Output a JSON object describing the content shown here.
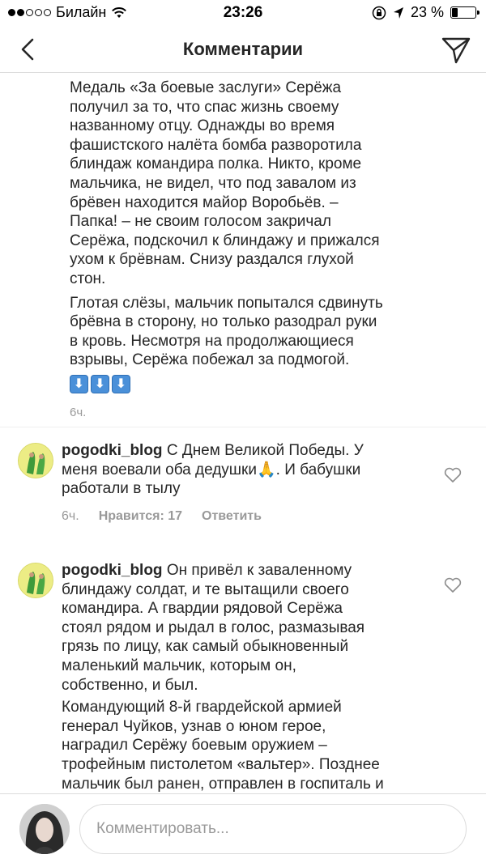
{
  "status_bar": {
    "carrier": "Билайн",
    "time": "23:26",
    "battery_percent": "23 %",
    "battery_level": 0.23,
    "signal_bars_filled": 2,
    "signal_bars_total": 5
  },
  "header": {
    "title": "Комментарии"
  },
  "continued_comment": {
    "paragraphs": [
      "Медаль «За боевые заслуги» Серёжа\nполучил за то, что спас жизнь своему\nназванному отцу. Однажды во время\nфашистского налёта бомба разворотила\nблиндаж командира полка. Никто, кроме\nмальчика, не видел, что под завалом из\nбрёвен находится майор Воробьёв. –\nПапка! – не своим голосом закричал\nСерёжа, подскочил к блиндажу и прижался\nухом к брёвнам. Снизу раздался глухой\nстон.",
      "Глотая слёзы, мальчик попытался сдвинуть\nбрёвна в сторону, но только разодрал руки\nв кровь. Несмотря на продолжающиеся\nвзрывы, Серёжа побежал за подмогой."
    ],
    "emoji": [
      "⬇",
      "⬇",
      "⬇"
    ],
    "time": "6ч."
  },
  "comments": [
    {
      "username": "pogodki_blog",
      "text": " С Днем Великой Победы. У\nменя воевали оба дедушки🙏. И бабушки\nработали в тылу",
      "time": "6ч.",
      "likes": "Нравится: 17",
      "reply": "Ответить"
    },
    {
      "username": "pogodki_blog",
      "text": " Он привёл к заваленному\nблиндажу солдат, и те вытащили своего\nкомандира. А гвардии рядовой Серёжа\nстоял рядом и рыдал в голос, размазывая\nгрязь по лицу, как самый обыкновенный\nмаленький мальчик, которым он,\nсобственно, и был.",
      "text2": "Командующий 8-й гвардейской армией\nгенерал Чуйков, узнав о юном герое,\nнаградил Серёжу боевым оружием –\nтрофейным пистолетом «вальтер». Позднее\nмальчик был ранен, отправлен в госпиталь и"
    }
  ],
  "input": {
    "placeholder": "Комментировать..."
  },
  "colors": {
    "text": "#262626",
    "meta": "#999999",
    "divider": "#efefef",
    "emoji_blue": "#4a90d9",
    "avatar_bg": "#e9e97a"
  }
}
